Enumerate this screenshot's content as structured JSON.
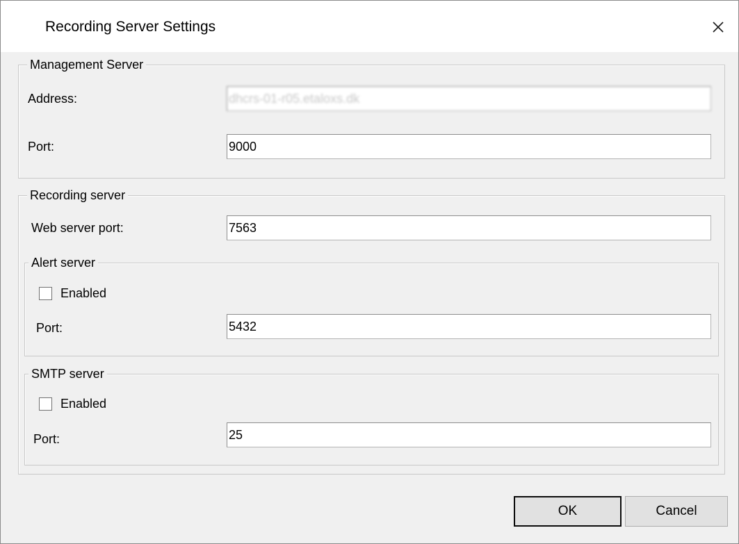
{
  "window": {
    "title": "Recording Server Settings",
    "close_icon": "close-icon"
  },
  "management_server": {
    "legend": "Management Server",
    "address_label": "Address:",
    "address_value": "dhcrs-01-r05.etaloxs.dk",
    "port_label": "Port:",
    "port_value": "9000"
  },
  "recording_server": {
    "legend": "Recording server",
    "web_port_label": "Web server port:",
    "web_port_value": "7563",
    "alert_server": {
      "legend": "Alert server",
      "enabled_label": "Enabled",
      "enabled_checked": false,
      "port_label": "Port:",
      "port_value": "5432"
    },
    "smtp_server": {
      "legend": "SMTP server",
      "enabled_label": "Enabled",
      "enabled_checked": false,
      "port_label": "Port:",
      "port_value": "25"
    }
  },
  "buttons": {
    "ok_label": "OK",
    "cancel_label": "Cancel"
  }
}
